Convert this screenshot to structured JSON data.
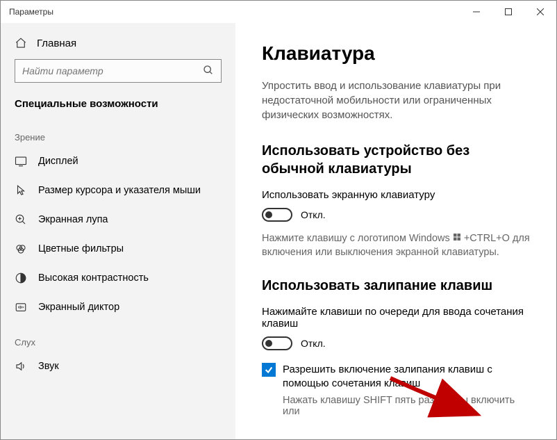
{
  "window": {
    "title": "Параметры"
  },
  "sidebar": {
    "home": "Главная",
    "search_placeholder": "Найти параметр",
    "section_title": "Специальные возможности",
    "groups": {
      "vision": "Зрение",
      "hearing": "Слух"
    },
    "items": [
      {
        "icon": "display",
        "label": "Дисплей"
      },
      {
        "icon": "cursor",
        "label": "Размер курсора и указателя мыши"
      },
      {
        "icon": "magnifier",
        "label": "Экранная лупа"
      },
      {
        "icon": "color",
        "label": "Цветные фильтры"
      },
      {
        "icon": "contrast",
        "label": "Высокая контрастность"
      },
      {
        "icon": "narrator",
        "label": "Экранный диктор"
      },
      {
        "icon": "sound",
        "label": "Звук"
      }
    ]
  },
  "content": {
    "heading": "Клавиатура",
    "description": "Упростить ввод и использование клавиатуры при недостаточной мобильности или ограниченных физических возможностях.",
    "section1": {
      "title": "Использовать устройство без обычной клавиатуры",
      "toggle_label": "Использовать экранную клавиатуру",
      "toggle_state": "Откл.",
      "hint_pre": "Нажмите клавишу с логотипом Windows ",
      "hint_post": " +CTRL+O для включения или выключения экранной клавиатуры."
    },
    "section2": {
      "title": "Использовать залипание клавиш",
      "toggle_label": "Нажимайте клавиши по очереди для ввода сочетания клавиш",
      "toggle_state": "Откл.",
      "checkbox_label": "Разрешить включение залипания клавиш с помощью сочетания клавиш",
      "checkbox_hint": "Нажать клавишу SHIFT пять раз, чтобы включить или"
    }
  }
}
